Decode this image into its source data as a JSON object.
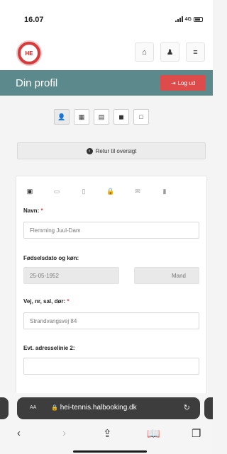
{
  "status": {
    "time": "16.07",
    "network": "4G"
  },
  "header": {
    "logo_text": "HE",
    "home_icon": "home-icon",
    "user_icon": "user-icon",
    "menu_icon": "menu-icon"
  },
  "titlebar": {
    "title": "Din profil",
    "logout_label": "Log ud",
    "logout_icon": "sign-out-icon"
  },
  "toolbar": {
    "buttons": [
      {
        "icon": "user-icon",
        "glyph": "👤"
      },
      {
        "icon": "calendar-icon",
        "glyph": "▦"
      },
      {
        "icon": "id-card-icon",
        "glyph": "▤"
      },
      {
        "icon": "file-icon",
        "glyph": "◼"
      },
      {
        "icon": "document-icon",
        "glyph": "□"
      }
    ]
  },
  "back": {
    "label": "Retur til oversigt"
  },
  "form": {
    "tabs": [
      {
        "icon": "id-card-icon",
        "glyph": "▣"
      },
      {
        "icon": "address-card-icon",
        "glyph": "▭"
      },
      {
        "icon": "document-icon",
        "glyph": "▯"
      },
      {
        "icon": "lock-icon",
        "glyph": "🔒"
      },
      {
        "icon": "envelope-icon",
        "glyph": "✉"
      },
      {
        "icon": "file-icon",
        "glyph": "▮"
      }
    ],
    "name": {
      "label": "Navn:",
      "required": "*",
      "value": "Flemming Juul-Dam"
    },
    "birth": {
      "label": "Fødselsdato og køn:",
      "date": "25-05-1952",
      "gender": "Mand"
    },
    "street": {
      "label": "Vej, nr, sal, dør:",
      "required": "*",
      "value": "Strandvangsvej 84"
    },
    "address2": {
      "label": "Evt. adresselinie 2:",
      "value": ""
    }
  },
  "browser": {
    "aa": "AA",
    "url": "hei-tennis.halbooking.dk",
    "lock_icon": "lock-icon",
    "reload_icon": "reload-icon"
  }
}
